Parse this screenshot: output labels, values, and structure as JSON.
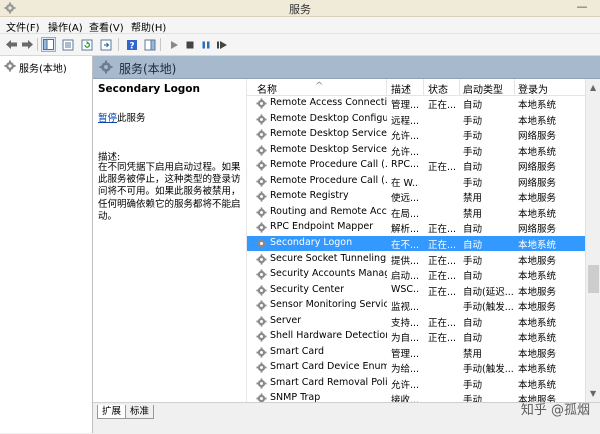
{
  "window": {
    "title": "服务",
    "minimize_glyph": "—"
  },
  "menu": [
    "文件(F)",
    "操作(A)",
    "查看(V)",
    "帮助(H)"
  ],
  "tree": {
    "root_label": "服务(本地)"
  },
  "pane": {
    "title": "服务(本地)"
  },
  "details": {
    "service_name": "Secondary Logon",
    "action_link": "暂停",
    "action_suffix": "此服务",
    "desc_label": "描述:",
    "desc_text": "在不同凭据下启用启动过程。如果此服务被停止，这种类型的登录访问将不可用。如果此服务被禁用，任何明确依赖它的服务都将不能启动。"
  },
  "columns": {
    "name": "名称",
    "desc": "描述",
    "status": "状态",
    "startup": "启动类型",
    "logon": "登录为"
  },
  "services": [
    {
      "name": "Remote Access Connecti...",
      "desc": "管理...",
      "status": "正在...",
      "startup": "自动",
      "logon": "本地系统",
      "selected": false
    },
    {
      "name": "Remote Desktop Configu...",
      "desc": "远程...",
      "status": "",
      "startup": "手动",
      "logon": "本地系统",
      "selected": false
    },
    {
      "name": "Remote Desktop Services",
      "desc": "允许...",
      "status": "",
      "startup": "手动",
      "logon": "网络服务",
      "selected": false
    },
    {
      "name": "Remote Desktop Service...",
      "desc": "允许...",
      "status": "",
      "startup": "手动",
      "logon": "本地系统",
      "selected": false
    },
    {
      "name": "Remote Procedure Call (...",
      "desc": "RPC...",
      "status": "正在...",
      "startup": "自动",
      "logon": "网络服务",
      "selected": false
    },
    {
      "name": "Remote Procedure Call (...",
      "desc": "在 W...",
      "status": "",
      "startup": "手动",
      "logon": "网络服务",
      "selected": false
    },
    {
      "name": "Remote Registry",
      "desc": "使远...",
      "status": "",
      "startup": "禁用",
      "logon": "本地服务",
      "selected": false
    },
    {
      "name": "Routing and Remote Acc...",
      "desc": "在局...",
      "status": "",
      "startup": "禁用",
      "logon": "本地系统",
      "selected": false
    },
    {
      "name": "RPC Endpoint Mapper",
      "desc": "解析...",
      "status": "正在...",
      "startup": "自动",
      "logon": "网络服务",
      "selected": false
    },
    {
      "name": "Secondary Logon",
      "desc": "在不...",
      "status": "正在...",
      "startup": "自动",
      "logon": "本地系统",
      "selected": true
    },
    {
      "name": "Secure Socket Tunneling ...",
      "desc": "提供...",
      "status": "正在...",
      "startup": "手动",
      "logon": "本地服务",
      "selected": false
    },
    {
      "name": "Security Accounts Manag...",
      "desc": "启动...",
      "status": "正在...",
      "startup": "自动",
      "logon": "本地系统",
      "selected": false
    },
    {
      "name": "Security Center",
      "desc": "WSC...",
      "status": "正在...",
      "startup": "自动(延迟...",
      "logon": "本地服务",
      "selected": false
    },
    {
      "name": "Sensor Monitoring Service",
      "desc": "监视...",
      "status": "",
      "startup": "手动(触发...",
      "logon": "本地服务",
      "selected": false
    },
    {
      "name": "Server",
      "desc": "支持...",
      "status": "正在...",
      "startup": "自动",
      "logon": "本地系统",
      "selected": false
    },
    {
      "name": "Shell Hardware Detection",
      "desc": "为自...",
      "status": "正在...",
      "startup": "自动",
      "logon": "本地系统",
      "selected": false
    },
    {
      "name": "Smart Card",
      "desc": "管理...",
      "status": "",
      "startup": "禁用",
      "logon": "本地服务",
      "selected": false
    },
    {
      "name": "Smart Card Device Enum...",
      "desc": "为给...",
      "status": "",
      "startup": "手动(触发...",
      "logon": "本地系统",
      "selected": false
    },
    {
      "name": "Smart Card Removal Poli...",
      "desc": "允许...",
      "status": "",
      "startup": "手动",
      "logon": "本地系统",
      "selected": false
    },
    {
      "name": "SNMP Trap",
      "desc": "接收...",
      "status": "",
      "startup": "手动",
      "logon": "本地服务",
      "selected": false
    }
  ],
  "tabs": [
    "扩展",
    "标准"
  ],
  "watermark": "知乎 @孤烟"
}
